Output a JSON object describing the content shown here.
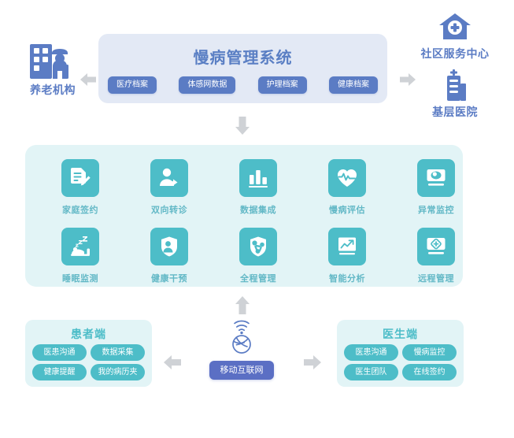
{
  "header": {
    "title": "慢病管理系统",
    "pills": [
      {
        "label": "医疗档案",
        "name": "pill-medical-records"
      },
      {
        "label": "体感网数据",
        "name": "pill-body-sensor-data"
      },
      {
        "label": "护理档案",
        "name": "pill-nursing-records"
      },
      {
        "label": "健康档案",
        "name": "pill-health-records"
      }
    ]
  },
  "left_entity": {
    "label": "养老机构",
    "icon": "building-with-elderly-person-icon"
  },
  "right_entities": [
    {
      "label": "社区服务中心",
      "icon": "community-clinic-house-cross-icon"
    },
    {
      "label": "基层医院",
      "icon": "primary-hospital-building-icon"
    }
  ],
  "services": {
    "row1": [
      {
        "label": "家庭签约",
        "icon": "document-sign-icon"
      },
      {
        "label": "双向转诊",
        "icon": "person-referral-icon"
      },
      {
        "label": "数据集成",
        "icon": "bar-chart-icon"
      },
      {
        "label": "慢病评估",
        "icon": "heart-pulse-icon"
      },
      {
        "label": "异常监控",
        "icon": "monitor-eye-icon"
      }
    ],
    "row2": [
      {
        "label": "睡眠监测",
        "icon": "sleeping-bed-zzz-icon"
      },
      {
        "label": "健康干预",
        "icon": "shield-person-plus-icon"
      },
      {
        "label": "全程管理",
        "icon": "shield-network-icon"
      },
      {
        "label": "智能分析",
        "icon": "trend-analysis-chart-icon"
      },
      {
        "label": "远程管理",
        "icon": "remote-monitor-cross-icon"
      }
    ]
  },
  "patient_panel": {
    "title": "患者端",
    "chips": [
      {
        "label": "医患沟通",
        "name": "chip-patient-doctor-communication"
      },
      {
        "label": "数据采集",
        "name": "chip-data-collection"
      },
      {
        "label": "健康提醒",
        "name": "chip-health-reminder"
      },
      {
        "label": "我的病历夹",
        "name": "chip-my-medical-records"
      }
    ]
  },
  "doctor_panel": {
    "title": "医生端",
    "chips": [
      {
        "label": "医患沟通",
        "name": "chip-doctor-patient-communication"
      },
      {
        "label": "慢病监控",
        "name": "chip-chronic-disease-monitoring"
      },
      {
        "label": "医生团队",
        "name": "chip-doctor-team"
      },
      {
        "label": "在线签约",
        "name": "chip-online-signing"
      }
    ]
  },
  "internet": {
    "label": "移动互联网",
    "icon": "wifi-globe-icon"
  },
  "colors": {
    "blue": "#5b7cc4",
    "blue_panel": "#e3e9f5",
    "teal": "#4dbdc8",
    "teal_panel": "#e2f4f6",
    "teal_text": "#62b8c6",
    "indigo": "#5b6fc4",
    "arrow_gray": "#cfd2d6"
  }
}
